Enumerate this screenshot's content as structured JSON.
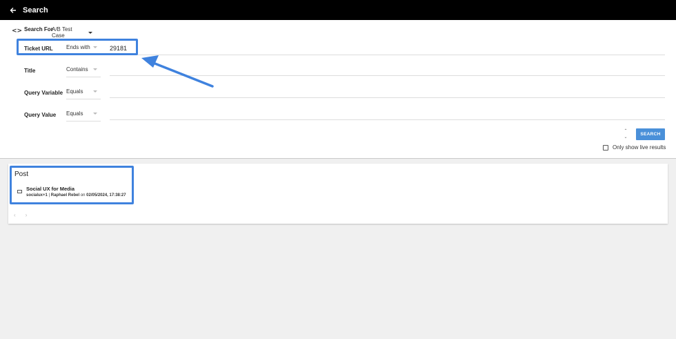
{
  "header": {
    "title": "Search",
    "back_icon": "arrow-left-icon"
  },
  "search_for": {
    "label": "Search For",
    "value": "A/B Test Case"
  },
  "filters": [
    {
      "label": "Ticket URL",
      "operator": "Ends with",
      "value": "29181"
    },
    {
      "label": "Title",
      "operator": "Contains",
      "value": ""
    },
    {
      "label": "Query Variable",
      "operator": "Equals",
      "value": ""
    },
    {
      "label": "Query Value",
      "operator": "Equals",
      "value": ""
    }
  ],
  "actions": {
    "search_label": "SEARCH",
    "live_results_label": "Only show live results",
    "live_results_checked": false
  },
  "results": {
    "heading": "Post",
    "items": [
      {
        "title": "Social UX for Media",
        "tags": "socialux+1",
        "separator": "|",
        "author": "Raphael Rebel",
        "on_text": "on",
        "datetime": "02/05/2024, 17:38:27"
      }
    ],
    "prev_icon": "chevron-left-icon",
    "next_icon": "chevron-right-icon"
  },
  "colors": {
    "accent": "#3f82de",
    "button": "#4a90d9",
    "header_bg": "#000000"
  }
}
